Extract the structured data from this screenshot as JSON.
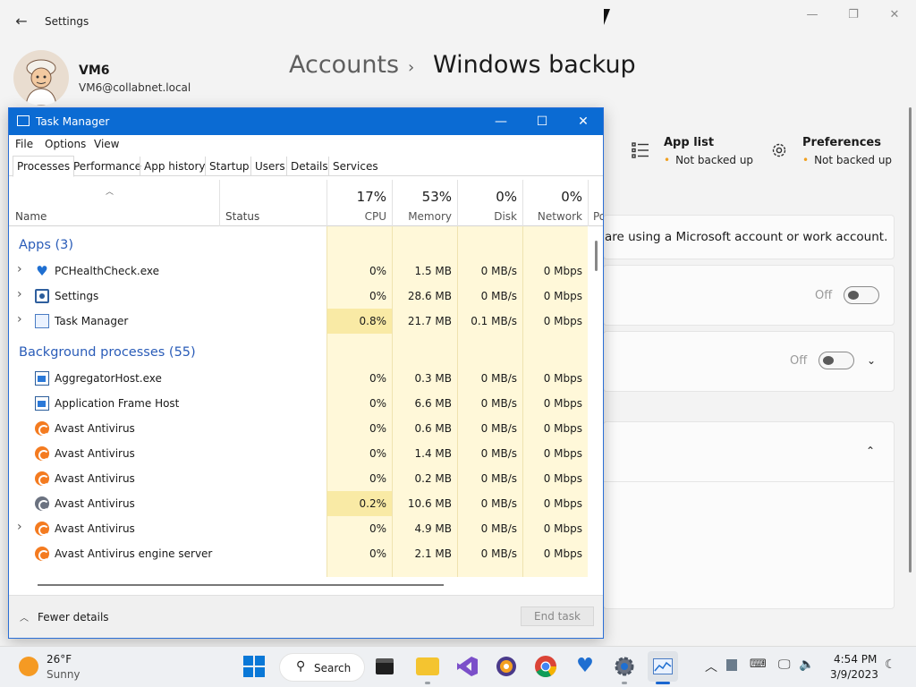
{
  "settings": {
    "window_title": "Settings",
    "user": {
      "name": "VM6",
      "email": "VM6@collabnet.local"
    },
    "breadcrumb": {
      "parent": "Accounts",
      "separator": "›",
      "current": "Windows backup"
    },
    "header_items": [
      {
        "title": "App list",
        "status": "Not backed up",
        "icon": "list-icon"
      },
      {
        "title": "Preferences",
        "status": "Not backed up",
        "icon": "gear-icon"
      }
    ],
    "info_text": "are using a Microsoft account or work account.",
    "toggles": [
      {
        "label": "Off"
      },
      {
        "label": "Off"
      }
    ]
  },
  "taskmanager": {
    "title": "Task Manager",
    "menu": [
      "File",
      "Options",
      "View"
    ],
    "tabs": [
      "Processes",
      "Performance",
      "App history",
      "Startup",
      "Users",
      "Details",
      "Services"
    ],
    "active_tab": "Processes",
    "columns": {
      "name": "Name",
      "status": "Status",
      "cpu": {
        "label": "CPU",
        "pct": "17%"
      },
      "memory": {
        "label": "Memory",
        "pct": "53%"
      },
      "disk": {
        "label": "Disk",
        "pct": "0%"
      },
      "network": {
        "label": "Network",
        "pct": "0%"
      },
      "power": "Po"
    },
    "groups": [
      {
        "label": "Apps (3)"
      },
      {
        "label": "Background processes (55)"
      }
    ],
    "apps": [
      {
        "name": "PCHealthCheck.exe",
        "icon": "health-heart-icon",
        "expandable": true,
        "cpu": "0%",
        "memory": "1.5 MB",
        "disk": "0 MB/s",
        "network": "0 Mbps"
      },
      {
        "name": "Settings",
        "icon": "settings-app-icon",
        "expandable": true,
        "cpu": "0%",
        "memory": "28.6 MB",
        "disk": "0 MB/s",
        "network": "0 Mbps"
      },
      {
        "name": "Task Manager",
        "icon": "task-manager-icon",
        "expandable": true,
        "cpu": "0.8%",
        "memory": "21.7 MB",
        "disk": "0.1 MB/s",
        "network": "0 Mbps"
      }
    ],
    "background": [
      {
        "name": "AggregatorHost.exe",
        "icon": "window-icon",
        "expandable": false,
        "cpu": "0%",
        "memory": "0.3 MB",
        "disk": "0 MB/s",
        "network": "0 Mbps"
      },
      {
        "name": "Application Frame Host",
        "icon": "window-icon",
        "expandable": false,
        "cpu": "0%",
        "memory": "6.6 MB",
        "disk": "0 MB/s",
        "network": "0 Mbps"
      },
      {
        "name": "Avast Antivirus",
        "icon": "avast-icon",
        "expandable": false,
        "cpu": "0%",
        "memory": "0.6 MB",
        "disk": "0 MB/s",
        "network": "0 Mbps"
      },
      {
        "name": "Avast Antivirus",
        "icon": "avast-icon",
        "expandable": false,
        "cpu": "0%",
        "memory": "1.4 MB",
        "disk": "0 MB/s",
        "network": "0 Mbps"
      },
      {
        "name": "Avast Antivirus",
        "icon": "avast-icon",
        "expandable": false,
        "cpu": "0%",
        "memory": "0.2 MB",
        "disk": "0 MB/s",
        "network": "0 Mbps"
      },
      {
        "name": "Avast Antivirus",
        "icon": "avast-grey-icon",
        "expandable": false,
        "cpu": "0.2%",
        "memory": "10.6 MB",
        "disk": "0 MB/s",
        "network": "0 Mbps"
      },
      {
        "name": "Avast Antivirus",
        "icon": "avast-icon",
        "expandable": true,
        "cpu": "0%",
        "memory": "4.9 MB",
        "disk": "0 MB/s",
        "network": "0 Mbps"
      },
      {
        "name": "Avast Antivirus engine server",
        "icon": "avast-icon",
        "expandable": false,
        "cpu": "0%",
        "memory": "2.1 MB",
        "disk": "0 MB/s",
        "network": "0 Mbps"
      }
    ],
    "footer": {
      "fewer_details": "Fewer details",
      "end_task": "End task"
    }
  },
  "taskbar": {
    "weather": {
      "temp": "26°F",
      "condition": "Sunny"
    },
    "search_label": "Search",
    "time": "4:54 PM",
    "date": "3/9/2023"
  },
  "colors": {
    "accent": "#0b6bd3",
    "group_header": "#2a5cb8",
    "metric_bg": "#fff8d9",
    "avast": "#f47b20"
  }
}
